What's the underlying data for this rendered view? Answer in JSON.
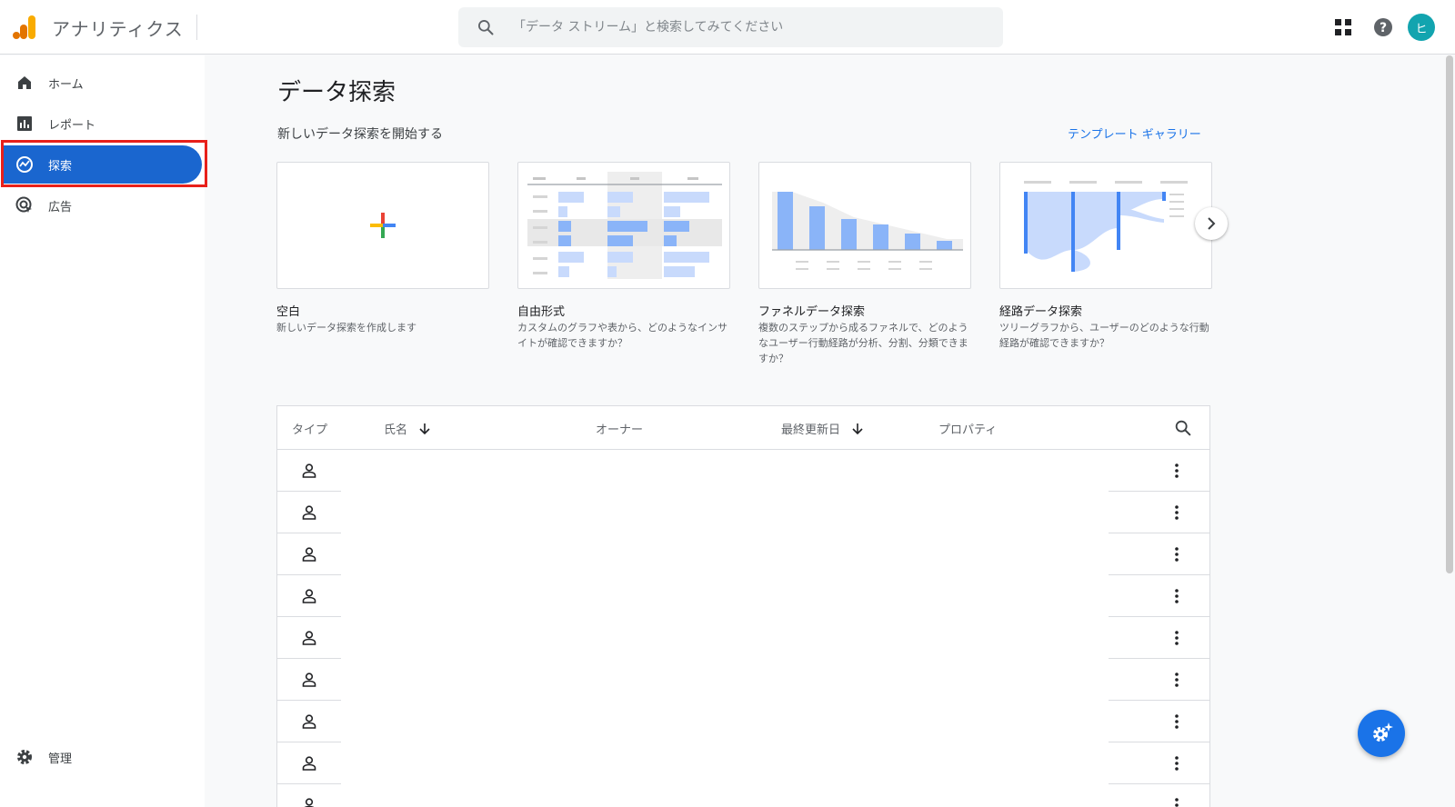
{
  "app": {
    "title": "アナリティクス",
    "avatar_initial": "ヒ"
  },
  "search": {
    "placeholder": "「データ ストリーム」と検索してみてください"
  },
  "sidebar": {
    "items": [
      {
        "label": "ホーム",
        "icon": "home-icon"
      },
      {
        "label": "レポート",
        "icon": "bar-chart-icon"
      },
      {
        "label": "探索",
        "icon": "explore-icon",
        "active": true
      },
      {
        "label": "広告",
        "icon": "ads-icon"
      }
    ],
    "admin_label": "管理"
  },
  "main": {
    "title": "データ探索",
    "subtitle": "新しいデータ探索を開始する",
    "gallery_link": "テンプレート ギャラリー",
    "cards": [
      {
        "title": "空白",
        "desc": "新しいデータ探索を作成します"
      },
      {
        "title": "自由形式",
        "desc": "カスタムのグラフや表から、どのようなインサイトが確認できますか？"
      },
      {
        "title": "ファネルデータ探索",
        "desc": "複数のステップから成るファネルで、どのようなユーザー行動経路が分析、分割、分類できますか？"
      },
      {
        "title": "経路データ探索",
        "desc": "ツリーグラフから、ユーザーのどのような行動経路が確認できますか？"
      }
    ]
  },
  "table": {
    "headers": {
      "type": "タイプ",
      "name": "氏名",
      "owner": "オーナー",
      "updated": "最終更新日",
      "property": "プロパティ"
    },
    "row_count": 9
  },
  "colors": {
    "accent": "#1a66cf",
    "highlight": "#e8201a",
    "link": "#1a73e8"
  }
}
